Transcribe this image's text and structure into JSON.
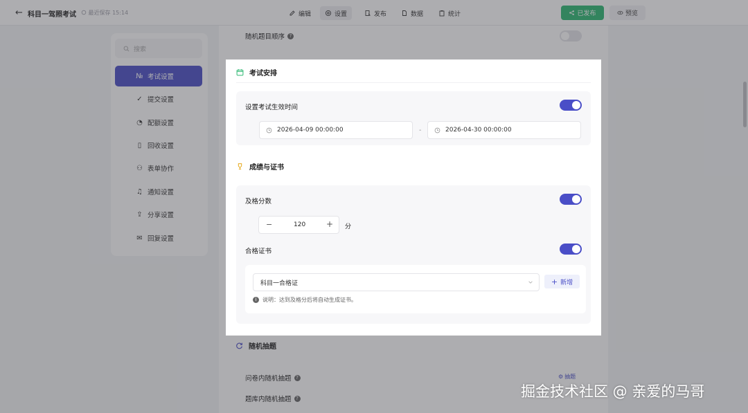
{
  "header": {
    "back_glyph": "←",
    "title": "科目一驾照考试",
    "save_status": "最近保存 15:14",
    "tabs": [
      {
        "label": "编辑",
        "icon": "edit-icon"
      },
      {
        "label": "设置",
        "icon": "gear-icon"
      },
      {
        "label": "发布",
        "icon": "publish-icon"
      },
      {
        "label": "数据",
        "icon": "file-icon"
      },
      {
        "label": "统计",
        "icon": "clipboard-icon"
      }
    ],
    "active_tab": "设置",
    "publish_label": "已发布",
    "preview_label": "预览"
  },
  "sidebar": {
    "search_placeholder": "搜索",
    "items": [
      {
        "label": "考试设置",
        "icon": "number-icon",
        "glyph": "№"
      },
      {
        "label": "提交设置",
        "icon": "check-circle-icon",
        "glyph": "✓"
      },
      {
        "label": "配额设置",
        "icon": "pie-icon",
        "glyph": "◔"
      },
      {
        "label": "回收设置",
        "icon": "phone-icon",
        "glyph": "▯"
      },
      {
        "label": "表单协作",
        "icon": "users-icon",
        "glyph": "⚇"
      },
      {
        "label": "通知设置",
        "icon": "bell-icon",
        "glyph": "♫"
      },
      {
        "label": "分享设置",
        "icon": "share-icon",
        "glyph": "⇪"
      },
      {
        "label": "回复设置",
        "icon": "reply-icon",
        "glyph": "✉"
      }
    ],
    "active": "考试设置"
  },
  "background": {
    "random_order_label": "随机题目顺序",
    "random_order_on": false,
    "random_draw_title": "随机抽题",
    "in_survey_label": "问卷内随机抽题",
    "in_bank_label": "题库内随机抽题",
    "draw_link_label": "抽题"
  },
  "modal": {
    "exam_section": {
      "title": "考试安排",
      "effective_time_label": "设置考试生效时间",
      "effective_time_on": true,
      "start": "2026-04-09 00:00:00",
      "separator": "-",
      "end": "2026-04-30 00:00:00"
    },
    "score_section": {
      "title": "成绩与证书",
      "pass_score_label": "及格分数",
      "pass_score_on": true,
      "pass_score": "120",
      "score_unit": "分",
      "minus_glyph": "−",
      "plus_glyph": "+",
      "certificate_label": "合格证书",
      "certificate_on": true,
      "certificate_value": "科目一合格证",
      "add_label": "新增",
      "note_text": "说明：达到及格分后将自动生成证书。"
    }
  },
  "watermark": "掘金技术社区 @ 亲爱的马哥",
  "colors": {
    "accent": "#4a4ec7",
    "publish_green": "#2eb872",
    "overlay": "rgba(60,60,66,0.42)"
  }
}
